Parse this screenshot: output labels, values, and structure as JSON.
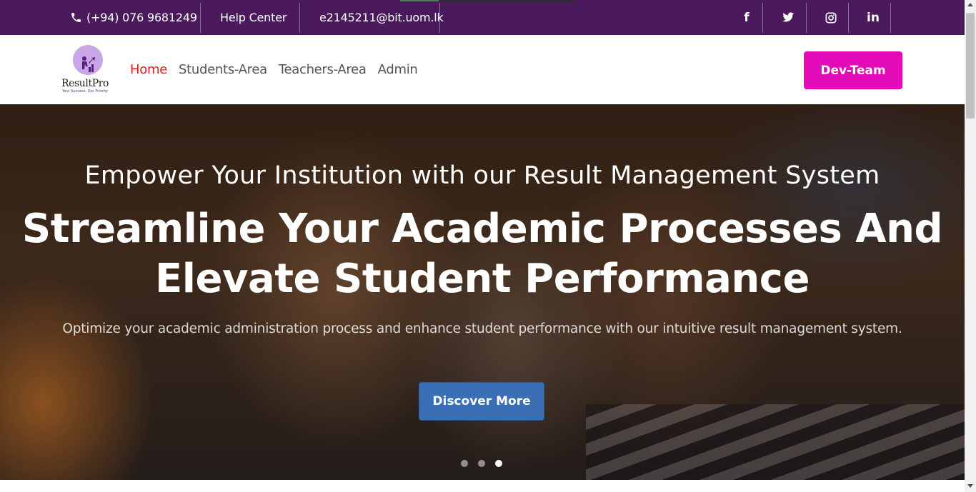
{
  "topbar": {
    "phone": "(+94) 076 9681249",
    "help": "Help Center",
    "email": "e2145211@bit.uom.lk",
    "social": [
      {
        "icon": "facebook-icon",
        "glyph": "f"
      },
      {
        "icon": "twitter-icon",
        "glyph": "🐦"
      },
      {
        "icon": "instagram-icon",
        "glyph": "◎"
      },
      {
        "icon": "linkedin-icon",
        "glyph": "in"
      }
    ],
    "bg_color": "#4a1a5c"
  },
  "logo": {
    "name": "ResultPro",
    "tagline": "Your Success, Our Priority"
  },
  "nav": {
    "items": [
      "Home",
      "Students-Area",
      "Teachers-Area",
      "Admin"
    ],
    "active": "Home",
    "cta": "Dev-Team",
    "cta_color": "#e30ab8",
    "active_color": "#e02020"
  },
  "hero": {
    "subtitle": "Empower Your Institution with our Result Management System",
    "title_line1": "Streamline Your Academic Processes And",
    "title_line2": "Elevate Student Performance",
    "description": "Optimize your academic administration process and enhance student performance with our intuitive result management system.",
    "button": "Discover More",
    "button_color": "#3a6fb5",
    "carousel_active": 3,
    "carousel_count": 3
  }
}
